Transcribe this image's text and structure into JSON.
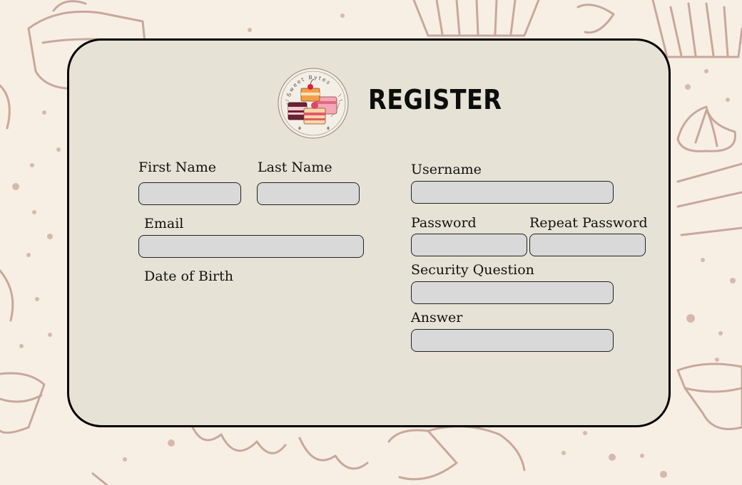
{
  "page": {
    "title": "REGISTER",
    "logo_text": "Sweet Bytes"
  },
  "colors": {
    "background": "#f7efe4",
    "doodle": "#c9a79c",
    "card": "#e6e2d5",
    "field": "#d9d9d9"
  },
  "icons": {
    "logo": "cake-slices-logo-icon",
    "background": "cupcake-doodle-pattern"
  },
  "form": {
    "first_name": {
      "label": "First Name",
      "value": ""
    },
    "last_name": {
      "label": "Last Name",
      "value": ""
    },
    "email": {
      "label": "Email",
      "value": ""
    },
    "dob": {
      "label": "Date of Birth"
    },
    "username": {
      "label": "Username",
      "value": ""
    },
    "password": {
      "label": "Password",
      "value": ""
    },
    "repeat_password": {
      "label": "Repeat Password",
      "value": ""
    },
    "security_question": {
      "label": "Security Question",
      "value": ""
    },
    "answer": {
      "label": "Answer",
      "value": ""
    }
  }
}
